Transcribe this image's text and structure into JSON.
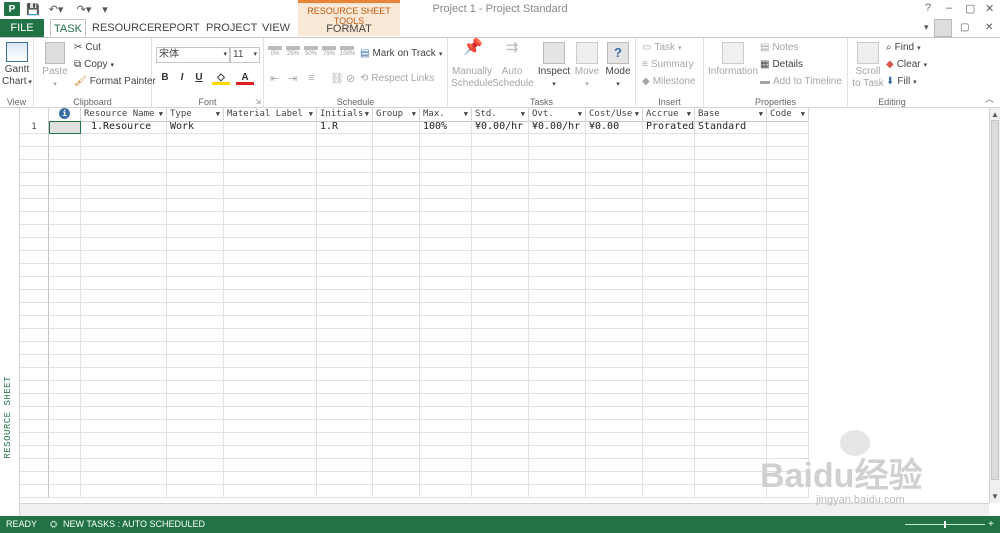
{
  "title_bar": {
    "title": "Project 1 - Project Standard",
    "help": "?",
    "minimize": "–",
    "restore": "▢",
    "close": "✕"
  },
  "context_tab": {
    "label": "RESOURCE SHEET TOOLS",
    "tab": "FORMAT"
  },
  "tabs": [
    "FILE",
    "TASK",
    "RESOURCE",
    "REPORT",
    "PROJECT",
    "VIEW"
  ],
  "ribbon": {
    "view": {
      "gantt": "Gantt",
      "chart": "Chart",
      "label": "View"
    },
    "clipboard": {
      "paste": "Paste",
      "cut": "Cut",
      "copy": "Copy",
      "format_painter": "Format Painter",
      "label": "Clipboard"
    },
    "font": {
      "family": "宋体",
      "size": "11",
      "bold": "B",
      "italic": "I",
      "underline": "U",
      "label": "Font"
    },
    "schedule": {
      "pcts": [
        "0%",
        "25%",
        "50%",
        "75%",
        "100%"
      ],
      "mark_on_track": "Mark on Track",
      "respect_links": "Respect Links",
      "label": "Schedule"
    },
    "tasks": {
      "manually": "Manually",
      "schedule1": "Schedule",
      "auto": "Auto",
      "schedule2": "Schedule",
      "inspect": "Inspect",
      "move": "Move",
      "mode": "Mode",
      "label": "Tasks"
    },
    "insert": {
      "task": "Task",
      "summary": "Summary",
      "milestone": "Milestone",
      "label": "Insert"
    },
    "properties": {
      "information": "Information",
      "notes": "Notes",
      "details": "Details",
      "add_timeline": "Add to Timeline",
      "label": "Properties"
    },
    "editing": {
      "scroll": "Scroll",
      "to_task": "to Task",
      "find": "Find",
      "clear": "Clear",
      "fill": "Fill",
      "label": "Editing"
    }
  },
  "sidebar_label": "RESOURCE SHEET",
  "columns": [
    {
      "label": "",
      "icon": "info-icon"
    },
    {
      "label": "Resource Name"
    },
    {
      "label": "Type"
    },
    {
      "label": "Material Label"
    },
    {
      "label": "Initials"
    },
    {
      "label": "Group"
    },
    {
      "label": "Max."
    },
    {
      "label": "Std."
    },
    {
      "label": "Ovt."
    },
    {
      "label": "Cost/Use"
    },
    {
      "label": "Accrue"
    },
    {
      "label": "Base"
    },
    {
      "label": "Code"
    }
  ],
  "rows": [
    {
      "num": "1",
      "cells": [
        "",
        "1.Resource",
        "Work",
        "",
        "1.R",
        "",
        "100%",
        "¥0.00/hr",
        "¥0.00/hr",
        "¥0.00",
        "Prorated",
        "Standard",
        ""
      ]
    }
  ],
  "status": {
    "ready": "READY",
    "new_tasks": "NEW TASKS : AUTO SCHEDULED"
  },
  "watermark": {
    "brand": "Baidu经验",
    "url": "jingyan.baidu.com"
  },
  "colors": {
    "accent": "#217346",
    "context": "#e8833a"
  }
}
